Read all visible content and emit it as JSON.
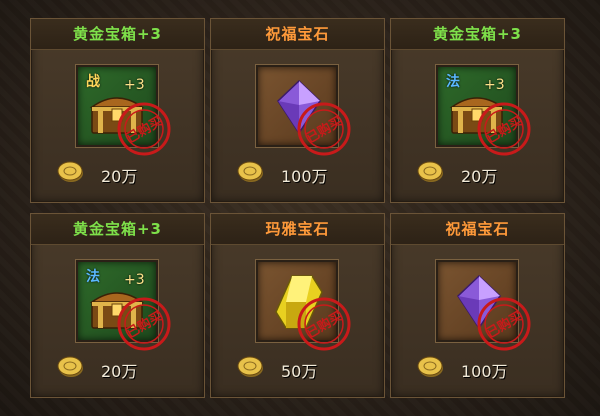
{
  "shop": {
    "items": [
      {
        "title": "黄金宝箱+3",
        "class_tag": "战",
        "plus": "+3",
        "stamp": "已购买",
        "price": "20万",
        "icon": "golden-chest-icon"
      },
      {
        "title": "祝福宝石",
        "stamp": "已购买",
        "price": "100万",
        "icon": "purple-gem-icon"
      },
      {
        "title": "黄金宝箱+3",
        "class_tag": "法",
        "plus": "+3",
        "stamp": "已购买",
        "price": "20万",
        "icon": "golden-chest-icon"
      },
      {
        "title": "黄金宝箱+3",
        "class_tag": "法",
        "plus": "+3",
        "stamp": "已购买",
        "price": "20万",
        "icon": "golden-chest-icon"
      },
      {
        "title": "玛雅宝石",
        "stamp": "已购买",
        "price": "50万",
        "icon": "yellow-gem-icon"
      },
      {
        "title": "祝福宝石",
        "stamp": "已购买",
        "price": "100万",
        "icon": "purple-gem-icon"
      }
    ]
  },
  "colors": {
    "title_green": "#7ee04a",
    "title_orange": "#ff9a3a",
    "stamp_red": "#c81a1a"
  }
}
